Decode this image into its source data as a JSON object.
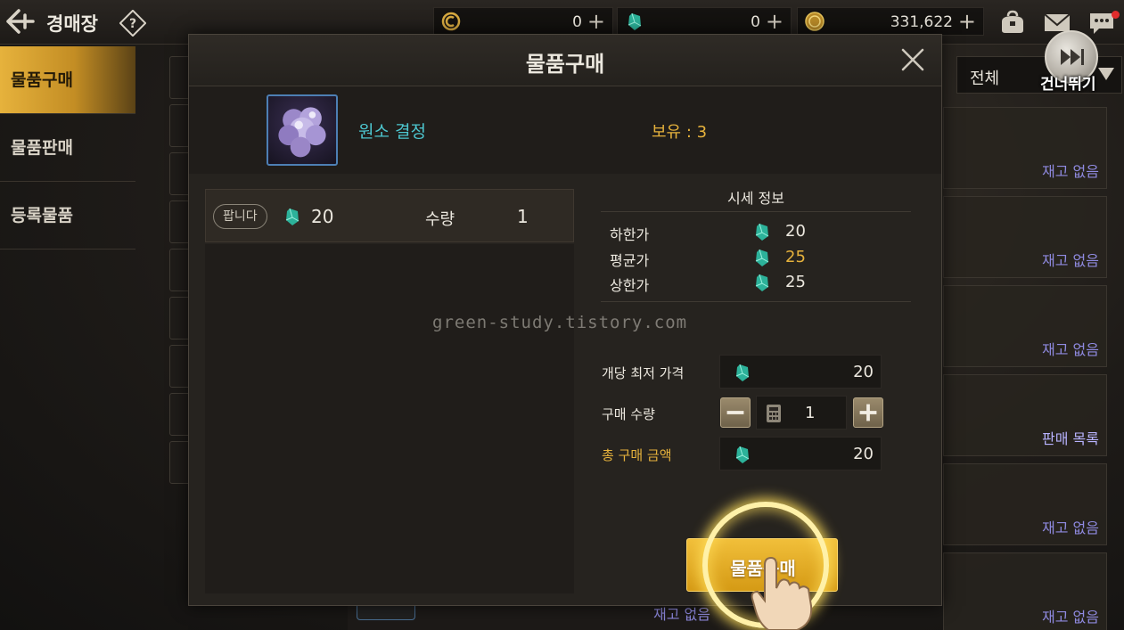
{
  "header": {
    "title": "경매장",
    "currencies": [
      {
        "icon": "crown-coin-icon",
        "value": "0"
      },
      {
        "icon": "green-gem-icon",
        "value": "0"
      },
      {
        "icon": "gold-coin-icon",
        "value": "331,622"
      }
    ],
    "plus_label": "+"
  },
  "sidebar": {
    "items": [
      {
        "label": "물품구매",
        "active": true
      },
      {
        "label": "물품판매",
        "active": false
      },
      {
        "label": "등록물품",
        "active": false
      }
    ]
  },
  "background": {
    "filter_label": "전체",
    "cards": [
      {
        "status": "재고 없음"
      },
      {
        "status": "재고 없음"
      },
      {
        "status": "재고 없음"
      },
      {
        "status": "판매 목록"
      },
      {
        "status": "재고 없음"
      },
      {
        "status": "재고 없음"
      }
    ],
    "bottom_status": "재고 없음"
  },
  "skip": {
    "label": "건너뛰기"
  },
  "modal": {
    "title": "물품구매",
    "item": {
      "name": "원소 결정",
      "owned": "보유 : 3"
    },
    "seller": {
      "badge": "팝니다",
      "price": "20",
      "qty_label": "수량",
      "qty": "1"
    },
    "market_info": {
      "title": "시세 정보",
      "rows": [
        {
          "label": "하한가",
          "value": "20"
        },
        {
          "label": "평균가",
          "value": "25"
        },
        {
          "label": "상한가",
          "value": "25"
        }
      ]
    },
    "form": {
      "unit_price_label": "개당 최저 가격",
      "unit_price": "20",
      "quantity_label": "구매 수량",
      "quantity": "1",
      "total_label": "총 구매 금액",
      "total": "20"
    },
    "buy_label": "물품구매"
  },
  "watermark": "green-study.tistory.com",
  "colors": {
    "accent_gold": "#e6b23c",
    "item_name": "#4dc6cf",
    "status_purple": "#8f8ae0"
  }
}
